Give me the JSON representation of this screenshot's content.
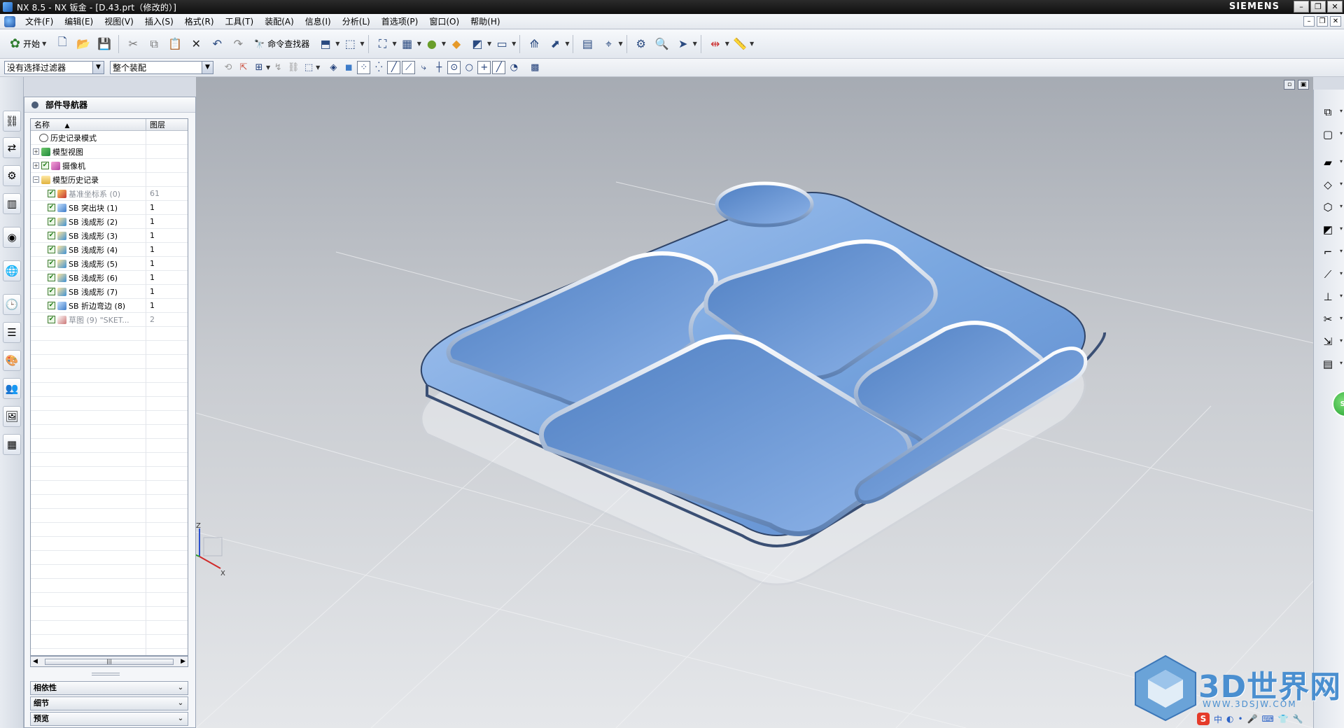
{
  "window": {
    "title": "NX 8.5 - NX 钣金 - [D.43.prt（修改的）]",
    "brand": "SIEMENS",
    "controls": [
      "–",
      "❐",
      "✕"
    ]
  },
  "menu": {
    "items": [
      "文件(F)",
      "编辑(E)",
      "视图(V)",
      "插入(S)",
      "格式(R)",
      "工具(T)",
      "装配(A)",
      "信息(I)",
      "分析(L)",
      "首选项(P)",
      "窗口(O)",
      "帮助(H)"
    ],
    "inner_controls": [
      "–",
      "❐",
      "✕"
    ]
  },
  "toolbar": {
    "start_label": "开始",
    "command_finder_label": "命令查找器"
  },
  "selection_bar": {
    "filter_value": "没有选择过滤器",
    "scope_value": "整个装配"
  },
  "navigator": {
    "title": "部件导航器",
    "columns": {
      "name": "名称",
      "layer": "图层"
    },
    "rows": [
      {
        "name": "历史记录模式",
        "layer": "",
        "icon": "history-icon",
        "exp": "",
        "check": false,
        "dim": false,
        "indent": 1
      },
      {
        "name": "模型视图",
        "layer": "",
        "icon": "model-view-icon",
        "exp": "+",
        "check": false,
        "dim": false,
        "indent": 0
      },
      {
        "name": "摄像机",
        "layer": "",
        "icon": "camera-icon",
        "exp": "+",
        "check": true,
        "dim": false,
        "indent": 0
      },
      {
        "name": "模型历史记录",
        "layer": "",
        "icon": "folder-icon",
        "exp": "−",
        "check": false,
        "dim": false,
        "indent": 0
      },
      {
        "name": "基准坐标系 (0)",
        "layer": "61",
        "icon": "datum-csys-icon",
        "exp": "",
        "check": true,
        "dim": true,
        "indent": 2
      },
      {
        "name": "SB 突出块 (1)",
        "layer": "1",
        "icon": "tab-feature-icon",
        "exp": "",
        "check": true,
        "dim": false,
        "indent": 2
      },
      {
        "name": "SB 浅成形 (2)",
        "layer": "1",
        "icon": "dimple-icon",
        "exp": "",
        "check": true,
        "dim": false,
        "indent": 2
      },
      {
        "name": "SB 浅成形 (3)",
        "layer": "1",
        "icon": "dimple-icon",
        "exp": "",
        "check": true,
        "dim": false,
        "indent": 2
      },
      {
        "name": "SB 浅成形 (4)",
        "layer": "1",
        "icon": "dimple-icon",
        "exp": "",
        "check": true,
        "dim": false,
        "indent": 2
      },
      {
        "name": "SB 浅成形 (5)",
        "layer": "1",
        "icon": "dimple-icon",
        "exp": "",
        "check": true,
        "dim": false,
        "indent": 2
      },
      {
        "name": "SB 浅成形 (6)",
        "layer": "1",
        "icon": "dimple-icon",
        "exp": "",
        "check": true,
        "dim": false,
        "indent": 2
      },
      {
        "name": "SB 浅成形 (7)",
        "layer": "1",
        "icon": "dimple-icon",
        "exp": "",
        "check": true,
        "dim": false,
        "indent": 2
      },
      {
        "name": "SB 折边弯边 (8)",
        "layer": "1",
        "icon": "hem-flange-icon",
        "exp": "",
        "check": true,
        "dim": false,
        "indent": 2
      },
      {
        "name": "草图 (9) \"SKET...",
        "layer": "2",
        "icon": "sketch-icon",
        "exp": "",
        "check": true,
        "dim": true,
        "indent": 2
      }
    ],
    "panels": [
      "相依性",
      "细节",
      "预览"
    ]
  },
  "viewport": {
    "triad_labels": {
      "z": "Z",
      "x": "X"
    }
  },
  "right_badge": "SB",
  "watermark": {
    "title": "3D世界网",
    "url": "WWW.3DSJW.COM",
    "ime_label": "中"
  },
  "colors": {
    "tray_blue": "#7aa7e0",
    "viewport_top": "#a6abb3",
    "viewport_bottom": "#e5e7ea"
  }
}
